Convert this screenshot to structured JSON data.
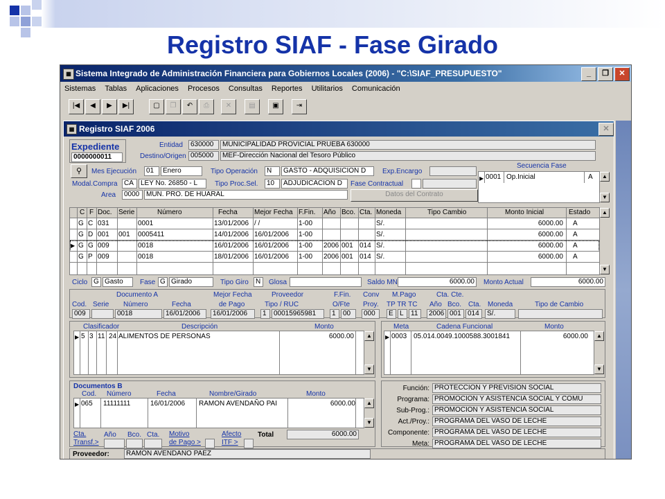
{
  "slide_title": "Registro SIAF - Fase Girado",
  "colors": {
    "title": "#1533a8",
    "accent_dark": "#0a246a",
    "accent_light": "#a6caf0"
  },
  "app": {
    "window_title": "Sistema Integrado de Administración Financiera para Gobiernos Locales (2006) - \"C:\\SIAF_PRESUPUESTO\"",
    "menu": [
      "Sistemas",
      "Tablas",
      "Aplicaciones",
      "Procesos",
      "Consultas",
      "Reportes",
      "Utilitarios",
      "Comunicación"
    ],
    "window_buttons": {
      "min": "_",
      "max": "❐",
      "close": "✕"
    }
  },
  "toolbar": {
    "icons": [
      "first-record-icon",
      "prev-record-icon",
      "next-record-icon",
      "last-record-icon",
      "new-icon",
      "copy-icon",
      "undo-icon",
      "print-icon",
      "delete-icon",
      "save-icon",
      "exit-icon"
    ]
  },
  "form": {
    "title": "Registro SIAF 2006",
    "close": "✕",
    "expediente": {
      "label": "Expediente",
      "value": "0000000011"
    },
    "entidad": {
      "label": "Entidad",
      "code": "630000",
      "name": "MUNICIPALIDAD PROVICIAL PRUEBA 630000"
    },
    "destino": {
      "label": "Destino/Origen",
      "code": "005000",
      "name": "MEF-Dirección Nacional del Tesoro Público"
    },
    "mes": {
      "label": "Mes Ejecución",
      "code": "01",
      "name": "Enero"
    },
    "tipo_operacion": {
      "label": "Tipo Operación",
      "code": "N",
      "name": "GASTO - ADQUISICION D"
    },
    "exp_encargo": {
      "label": "Exp.Encargo",
      "value": ""
    },
    "modal_compra": {
      "label": "Modal.Compra",
      "code": "CA",
      "name": "LEY No. 26850 - L"
    },
    "tipo_proc": {
      "label": "Tipo Proc.Sel.",
      "code": "10",
      "name": "ADJUDICACION D"
    },
    "fase_contractual": {
      "label": "Fase Contractual",
      "value": ""
    },
    "datos_contrato": "Datos del Contrato",
    "area": {
      "label": "Area",
      "code": "0000",
      "name": "MUN. PRO. DE HUARAL"
    },
    "secuencia": {
      "title": "Secuencia Fase",
      "code": "0001",
      "name": "Op.Inicial",
      "estado": "A"
    },
    "grid": {
      "headers": [
        "C",
        "F",
        "Doc.",
        "Serie",
        "Número",
        "Fecha",
        "Mejor Fecha",
        "F.Fin.",
        "Año",
        "Bco.",
        "Cta.",
        "Moneda",
        "Tipo Cambio",
        "Monto Inicial",
        "Estado"
      ],
      "rows": [
        [
          "G",
          "C",
          "031",
          "",
          "0001",
          "13/01/2006",
          "/ /",
          "1-00",
          "",
          "",
          "",
          "S/.",
          "",
          "6000.00",
          "A"
        ],
        [
          "G",
          "D",
          "001",
          "001",
          "0005411",
          "14/01/2006",
          "16/01/2006",
          "1-00",
          "",
          "",
          "",
          "S/.",
          "",
          "6000.00",
          "A"
        ],
        [
          "G",
          "G",
          "009",
          "",
          "0018",
          "16/01/2006",
          "16/01/2006",
          "1-00",
          "2006",
          "001",
          "014",
          "S/.",
          "",
          "6000.00",
          "A"
        ],
        [
          "G",
          "P",
          "009",
          "",
          "0018",
          "18/01/2006",
          "16/01/2006",
          "1-00",
          "2006",
          "001",
          "014",
          "S/.",
          "",
          "6000.00",
          "A"
        ]
      ]
    },
    "ciclo": {
      "label": "Ciclo",
      "code": "G",
      "name": "Gasto"
    },
    "fase": {
      "label": "Fase",
      "code": "G",
      "name": "Girado"
    },
    "tipo_giro": {
      "label": "Tipo Giro",
      "code": "N"
    },
    "glosa": {
      "label": "Glosa",
      "value": ""
    },
    "saldo_mn": {
      "label": "Saldo MN",
      "value": "6000.00"
    },
    "monto_actual": {
      "label": "Monto Actual",
      "value": "6000.00"
    },
    "documento_a": {
      "title": "Documento A",
      "cod_label": "Cod.",
      "serie_label": "Serie",
      "numero_label": "Número",
      "fecha_label": "Fecha",
      "cod": "009",
      "serie": "",
      "numero": "0018",
      "fecha": "16/01/2006"
    },
    "mejor_fecha": {
      "label1": "Mejor Fecha",
      "label2": "de Pago",
      "value": "16/01/2006"
    },
    "proveedor_box": {
      "title": "Proveedor",
      "sub": "Tipo / RUC",
      "tipo": "1",
      "ruc": "00015965981"
    },
    "ffin": {
      "label1": "F.Fin.",
      "label2": "O/Fte",
      "f": "1",
      "o": "00"
    },
    "conv": {
      "label1": "Conv",
      "label2": "Proy.",
      "value": "000"
    },
    "mpago": {
      "title": "M.Pago",
      "sub": "TP TR TC",
      "tp": "E",
      "tr": "L",
      "tc": "11"
    },
    "ctacte": {
      "title": "Cta. Cte.",
      "anio_label": "Año",
      "bco_label": "Bco.",
      "cta_label": "Cta.",
      "anio": "2006",
      "bco": "001",
      "cta": "014"
    },
    "moneda": {
      "label": "Moneda",
      "value": "S/."
    },
    "tipo_cambio": {
      "label": "Tipo de Cambio",
      "value": ""
    },
    "clasificador": {
      "headers": [
        "Clasificador",
        "Descripción",
        "Monto"
      ],
      "row": {
        "c1": "5",
        "c2": "3",
        "c3": "11",
        "c4": "24",
        "desc": "ALIMENTOS DE PERSONAS",
        "monto": "6000.00"
      }
    },
    "meta_grid": {
      "headers": [
        "Meta",
        "Cadena Funcional",
        "Monto"
      ],
      "row": {
        "meta": "0003",
        "cadena": "05.014.0049.1000588.3001841",
        "monto": "6000.00"
      }
    },
    "documentos_b": {
      "title": "Documentos B",
      "headers": [
        "Cod.",
        "Número",
        "Fecha",
        "Nombre/Girado",
        "Monto"
      ],
      "row": {
        "cod": "065",
        "numero": "11111111",
        "fecha": "16/01/2006",
        "nombre": "RAMON AVENDAÑO PAI",
        "monto": "6000.00"
      },
      "cta_transf": [
        "Cta.",
        "Transf.>"
      ],
      "anio": "Año",
      "bco": "Bco.",
      "cta": "Cta.",
      "motivo": [
        "Motivo",
        "de Pago >"
      ],
      "afecto": [
        "Afecto",
        "ITF >"
      ],
      "total_label": "Total",
      "total": "6000.00"
    },
    "funcional": [
      {
        "label": "Función:",
        "value": "PROTECCION Y PREVISION SOCIAL"
      },
      {
        "label": "Programa:",
        "value": "PROMOCION Y  ASISTENCIA SOCIAL Y COMU"
      },
      {
        "label": "Sub-Prog.:",
        "value": "PROMOCION Y ASISTENCIA SOCIAL"
      },
      {
        "label": "Act./Proy.:",
        "value": "PROGRAMA DEL VASO DE LECHE"
      },
      {
        "label": "Componente:",
        "value": "PROGRAMA DEL VASO DE LECHE"
      },
      {
        "label": "Meta:",
        "value": "PROGRAMA DEL VASO DE LECHE"
      }
    ],
    "proveedor_bar": {
      "label": "Proveedor:",
      "value": "RAMON AVENDAÑO PAEZ"
    }
  }
}
